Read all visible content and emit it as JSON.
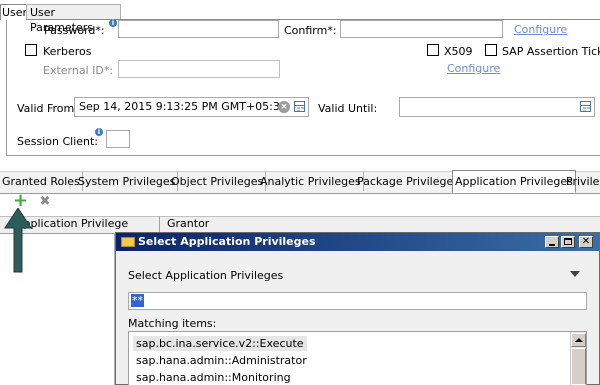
{
  "top_tabs": [
    "User",
    "User Parameters"
  ],
  "form": {
    "password_label": "Password*:",
    "confirm_label": "Confirm*:",
    "configure_link_1": "Configure",
    "kerberos_label": "Kerberos",
    "external_id_label": "External ID*:",
    "x509_label": "X509",
    "saml_label": "SAP Assertion Ticket",
    "configure_link_2": "Configure",
    "valid_from_label": "Valid From:",
    "valid_from_value": "Sep 14, 2015 9:13:25 PM GMT+05:30",
    "valid_until_label": "Valid Until:",
    "session_client_label": "Session Client:",
    "info_glyph": "i"
  },
  "priv_tabs": [
    "Granted Roles",
    "System Privileges",
    "Object Privileges",
    "Analytic Privileges",
    "Package Privileges",
    "Application Privileges",
    "Privileg"
  ],
  "toolbar": {
    "add_glyph": "+",
    "remove_glyph": "✖"
  },
  "grid": {
    "col1": "Application Privilege",
    "col2": "Grantor"
  },
  "dialog": {
    "title": "Select Application Privileges",
    "section_label": "Select Application Privileges",
    "search_value": "**",
    "matching_label": "Matching items:",
    "items": [
      "sap.bc.ina.service.v2::Execute",
      "sap.hana.admin::Administrator",
      "sap.hana.admin::Monitoring"
    ]
  },
  "colors": {
    "arrow": "#2e5c5a",
    "title_bar": "#0a246a",
    "selection": "#3366cc"
  }
}
